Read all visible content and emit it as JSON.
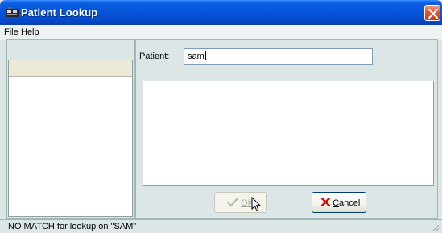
{
  "window": {
    "title": "Patient Lookup",
    "title_icon": "app-icon",
    "close_icon": "close-icon"
  },
  "menu": {
    "items": [
      {
        "label": "File"
      },
      {
        "label": "Help"
      }
    ]
  },
  "patient": {
    "label": "Patient:",
    "value": "sam"
  },
  "buttons": {
    "ok_label": "OK",
    "ok_icon": "checkmark-icon",
    "ok_enabled": false,
    "cancel_label": "Cancel",
    "cancel_icon": "red-x-icon"
  },
  "status": {
    "text": "NO MATCH for lookup on \"SAM\""
  },
  "colors": {
    "titlebar": "#0553d8",
    "window_bg": "#dce6e6",
    "close_button": "#e1542f",
    "cancel_x": "#c81010"
  }
}
